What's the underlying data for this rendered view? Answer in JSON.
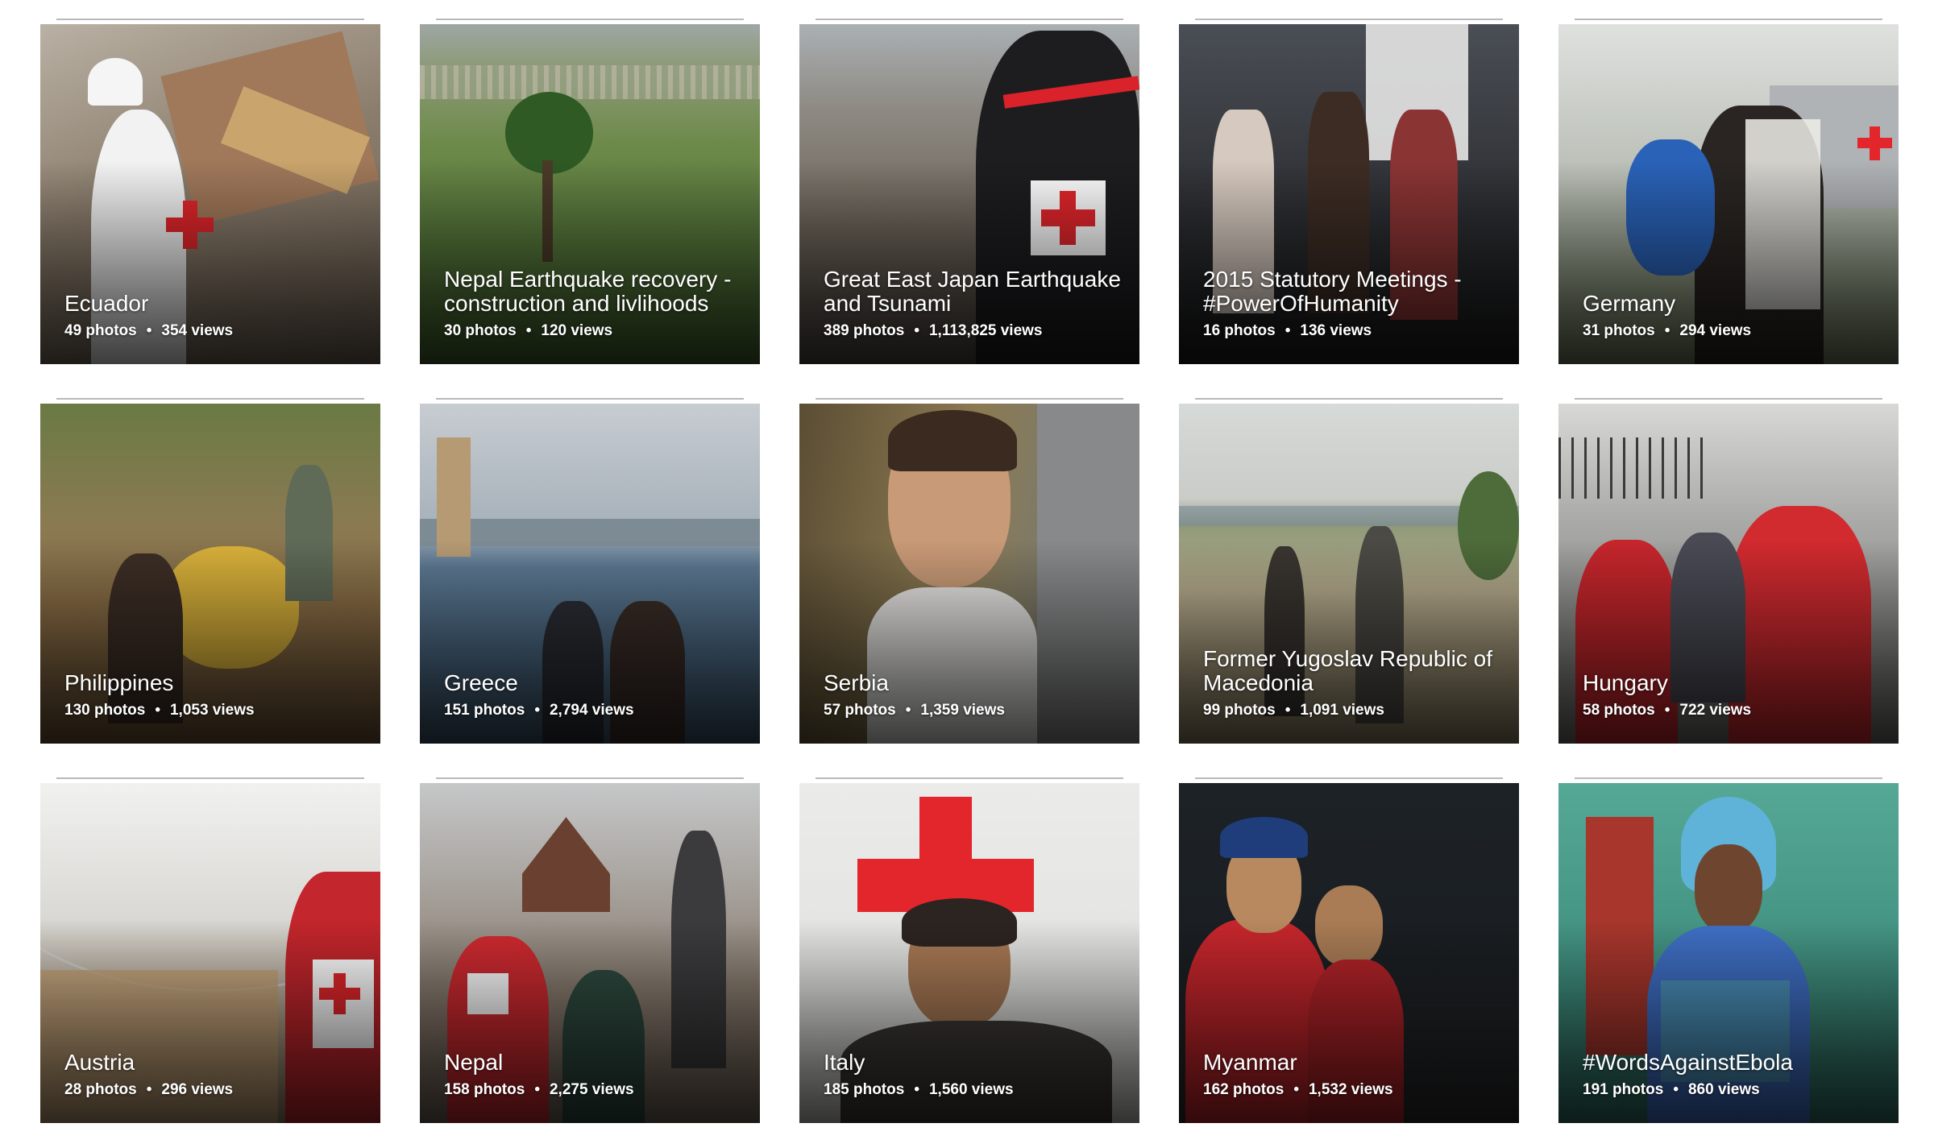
{
  "albums": [
    {
      "title": "Ecuador",
      "photos": "49 photos",
      "views": "354 views",
      "theme": "rubble",
      "bg": "#8a8276"
    },
    {
      "title": "Nepal Earthquake recovery - construction and livlihoods",
      "photos": "30 photos",
      "views": "120 views",
      "theme": "terraces",
      "bg": "#6b7f4a"
    },
    {
      "title": "Great East Japan Earthquake and Tsunami",
      "photos": "389 photos",
      "views": "1,113,825 views",
      "theme": "japan",
      "bg": "#6d6a66"
    },
    {
      "title": "2015 Statutory Meetings - #PowerOfHumanity",
      "photos": "16 photos",
      "views": "136 views",
      "theme": "stage",
      "bg": "#3a3a3c"
    },
    {
      "title": "Germany",
      "photos": "31 photos",
      "views": "294 views",
      "theme": "germany",
      "bg": "#8e9488"
    },
    {
      "title": "Philippines",
      "photos": "130 photos",
      "views": "1,053 views",
      "theme": "flood",
      "bg": "#7a6a48"
    },
    {
      "title": "Greece",
      "photos": "151 photos",
      "views": "2,794 views",
      "theme": "harbor",
      "bg": "#6f8396"
    },
    {
      "title": "Serbia",
      "photos": "57 photos",
      "views": "1,359 views",
      "theme": "boy",
      "bg": "#7d6e4f"
    },
    {
      "title": "Former Yugoslav Republic of Macedonia",
      "photos": "99 photos",
      "views": "1,091 views",
      "theme": "field",
      "bg": "#a39c86"
    },
    {
      "title": "Hungary",
      "photos": "58 photos",
      "views": "722 views",
      "theme": "hungary",
      "bg": "#9a9a98"
    },
    {
      "title": "Austria",
      "photos": "28 photos",
      "views": "296 views",
      "theme": "tent",
      "bg": "#cbc7c0"
    },
    {
      "title": "Nepal",
      "photos": "158 photos",
      "views": "2,275 views",
      "theme": "square",
      "bg": "#8a7d70"
    },
    {
      "title": "Italy",
      "photos": "185 photos",
      "views": "1,560 views",
      "theme": "italy",
      "bg": "#e6e6e4"
    },
    {
      "title": "Myanmar",
      "photos": "162 photos",
      "views": "1,532 views",
      "theme": "myanmar",
      "bg": "#1c2126"
    },
    {
      "title": "#WordsAgainstEbola",
      "photos": "191 photos",
      "views": "860 views",
      "theme": "ebola",
      "bg": "#4f9c8c"
    }
  ]
}
